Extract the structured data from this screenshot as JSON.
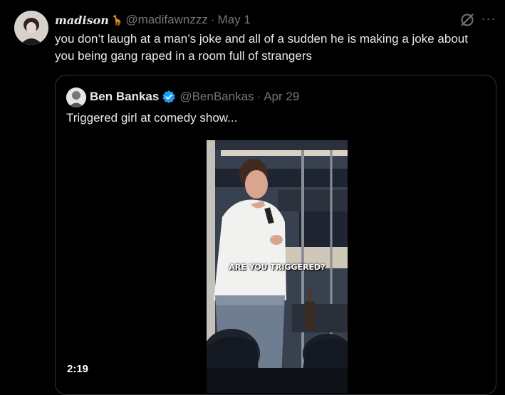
{
  "tweet": {
    "display_name": "madison",
    "name_emoji": "🦒",
    "handle": "@madifawnzzz",
    "separator": "·",
    "date": "May 1",
    "text": "you don’t laugh at a man’s joke and all of a sudden he is making a joke about you being gang raped in a room full of strangers",
    "icons": {
      "grok": "grok-icon",
      "more": "more-icon",
      "more_glyph": "···"
    }
  },
  "quote": {
    "display_name": "Ben Bankas",
    "handle": "@BenBankas",
    "separator": "·",
    "date": "Apr 29",
    "text": "Triggered girl at comedy show...",
    "video": {
      "caption": "ARE YOU TRIGGERED?",
      "duration": "2:19"
    }
  },
  "colors": {
    "background": "#000000",
    "text": "#e7e9ea",
    "muted": "#71767b",
    "border": "#2f3336",
    "verified": "#1d9bf0"
  }
}
